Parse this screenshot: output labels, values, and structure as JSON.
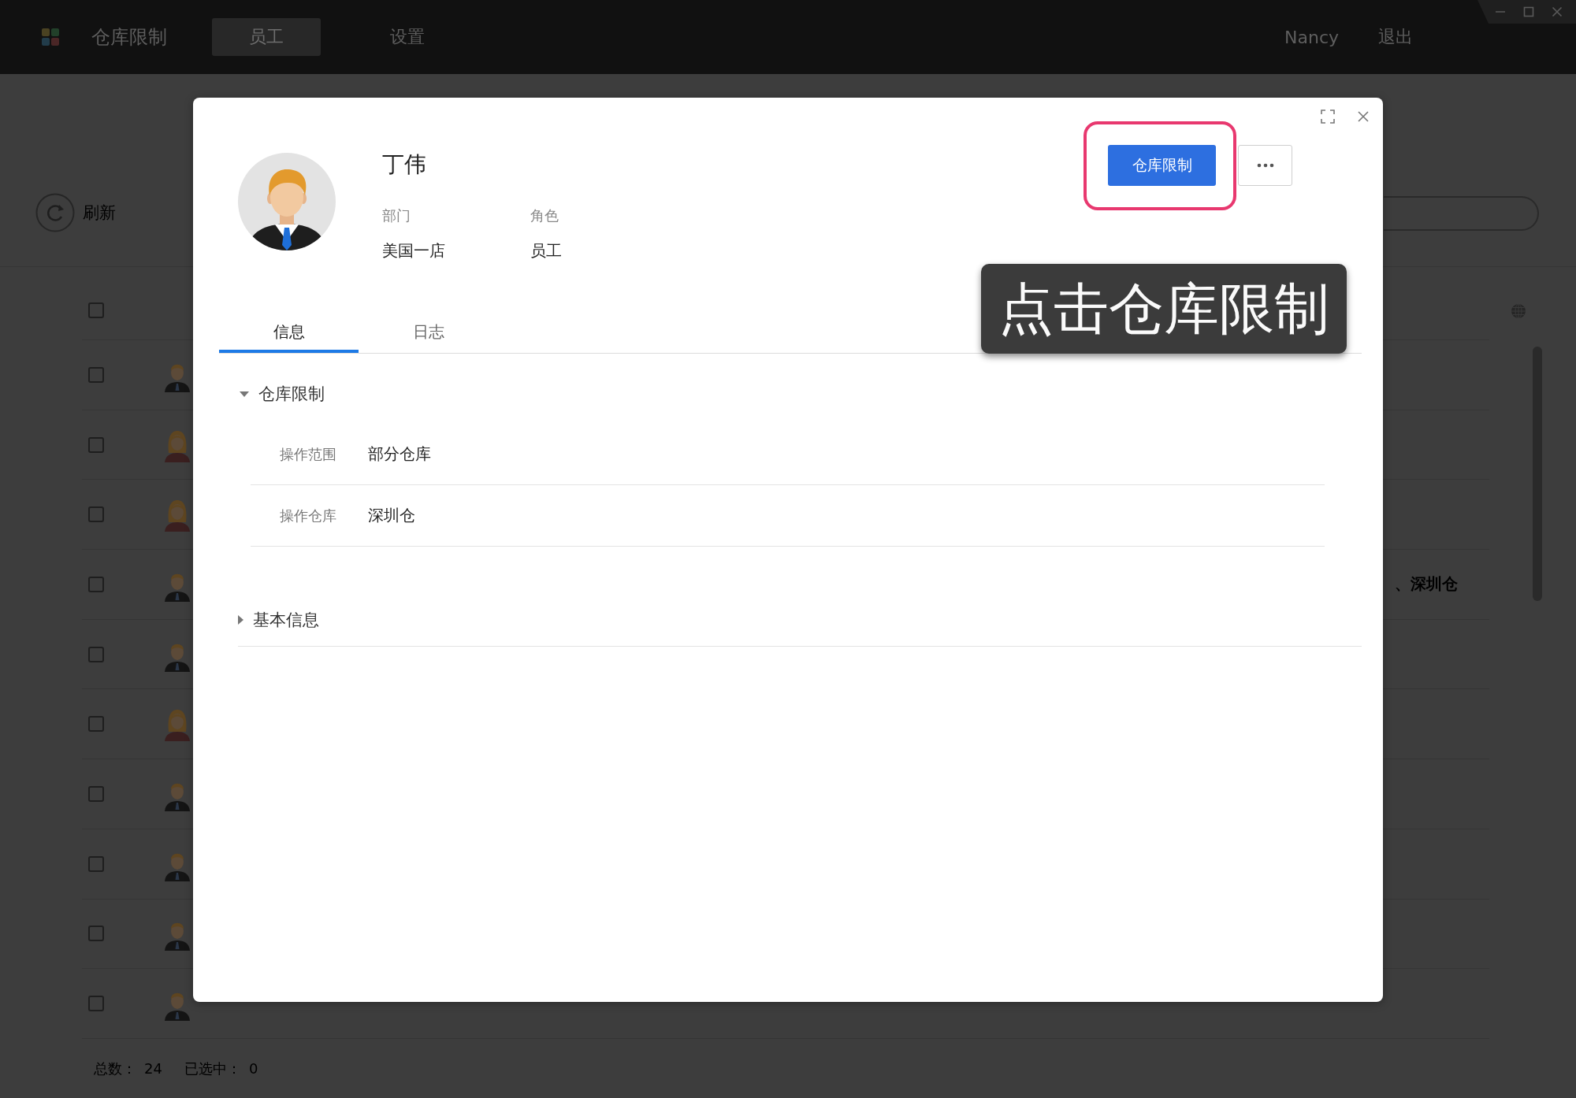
{
  "app_bar": {
    "title": "仓库限制",
    "nav": [
      {
        "label": "员工",
        "selected": true
      },
      {
        "label": "设置",
        "selected": false
      }
    ],
    "user": "Nancy",
    "logout": "退出"
  },
  "toolbar": {
    "refresh": "刷新"
  },
  "table": {
    "header": {
      "checked": false
    },
    "rows": [
      {
        "checked": false,
        "kind": "male"
      },
      {
        "checked": false,
        "kind": "female"
      },
      {
        "checked": false,
        "kind": "female"
      },
      {
        "checked": false,
        "kind": "male",
        "column_7": "、深圳仓"
      },
      {
        "checked": false,
        "kind": "male"
      },
      {
        "checked": false,
        "kind": "female"
      },
      {
        "checked": false,
        "kind": "male"
      },
      {
        "checked": false,
        "kind": "male"
      },
      {
        "checked": false,
        "kind": "male"
      },
      {
        "checked": false,
        "kind": "male"
      }
    ]
  },
  "status_bar": {
    "total_label": "总数：",
    "total": "24",
    "selected_label": "已选中：",
    "selected_count": "0"
  },
  "dialog": {
    "name": "丁伟",
    "fields": [
      {
        "label": "部门",
        "value": "美国一店"
      },
      {
        "label": "角色",
        "value": "员工"
      }
    ],
    "primary_action": {
      "label": "仓库限制",
      "highlighted": true
    },
    "tooltip": "点击仓库限制",
    "tabs": [
      {
        "label": "信息",
        "selected": true
      },
      {
        "label": "日志",
        "selected": false
      }
    ],
    "sections": [
      {
        "title": "仓库限制",
        "expanded": true,
        "rows": [
          {
            "label": "操作范围",
            "value": "部分仓库"
          },
          {
            "label": "操作仓库",
            "value": "深圳仓"
          }
        ]
      },
      {
        "title": "基本信息",
        "expanded": false
      }
    ]
  }
}
